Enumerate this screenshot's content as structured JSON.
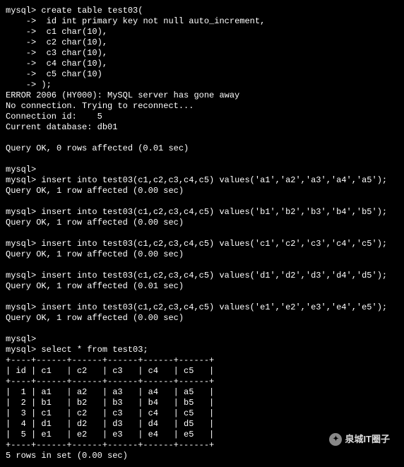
{
  "prompt": "mysql>",
  "cont_prompt": "    ->",
  "create_table": {
    "head": "create table test03(",
    "cols": [
      "id int primary key not null auto_increment,",
      "c1 char(10),",
      "c2 char(10),",
      "c3 char(10),",
      "c4 char(10),",
      "c5 char(10)"
    ],
    "tail": ");"
  },
  "error": {
    "l1": "ERROR 2006 (HY000): MySQL server has gone away",
    "l2": "No connection. Trying to reconnect...",
    "l3": "Connection id:    5",
    "l4": "Current database: db01"
  },
  "query_ok_0": "Query OK, 0 rows affected (0.01 sec)",
  "inserts": [
    {
      "sql": "insert into test03(c1,c2,c3,c4,c5) values('a1','a2','a3','a4','a5');",
      "result": "Query OK, 1 row affected (0.00 sec)"
    },
    {
      "sql": "insert into test03(c1,c2,c3,c4,c5) values('b1','b2','b3','b4','b5');",
      "result": "Query OK, 1 row affected (0.00 sec)"
    },
    {
      "sql": "insert into test03(c1,c2,c3,c4,c5) values('c1','c2','c3','c4','c5');",
      "result": "Query OK, 1 row affected (0.00 sec)"
    },
    {
      "sql": "insert into test03(c1,c2,c3,c4,c5) values('d1','d2','d3','d4','d5');",
      "result": "Query OK, 1 row affected (0.01 sec)"
    },
    {
      "sql": "insert into test03(c1,c2,c3,c4,c5) values('e1','e2','e3','e4','e5');",
      "result": "Query OK, 1 row affected (0.00 sec)"
    }
  ],
  "select_sql": "select * from test03;",
  "table": {
    "border": "+----+------+------+------+------+------+",
    "header": "| id | c1   | c2   | c3   | c4   | c5   |",
    "rows": [
      "|  1 | a1   | a2   | a3   | a4   | a5   |",
      "|  2 | b1   | b2   | b3   | b4   | b5   |",
      "|  3 | c1   | c2   | c3   | c4   | c5   |",
      "|  4 | d1   | d2   | d3   | d4   | d5   |",
      "|  5 | e1   | e2   | e3   | e4   | e5   |"
    ]
  },
  "rows_msg": "5 rows in set (0.00 sec)",
  "blank": " ",
  "watermark": "泉城IT圈子"
}
